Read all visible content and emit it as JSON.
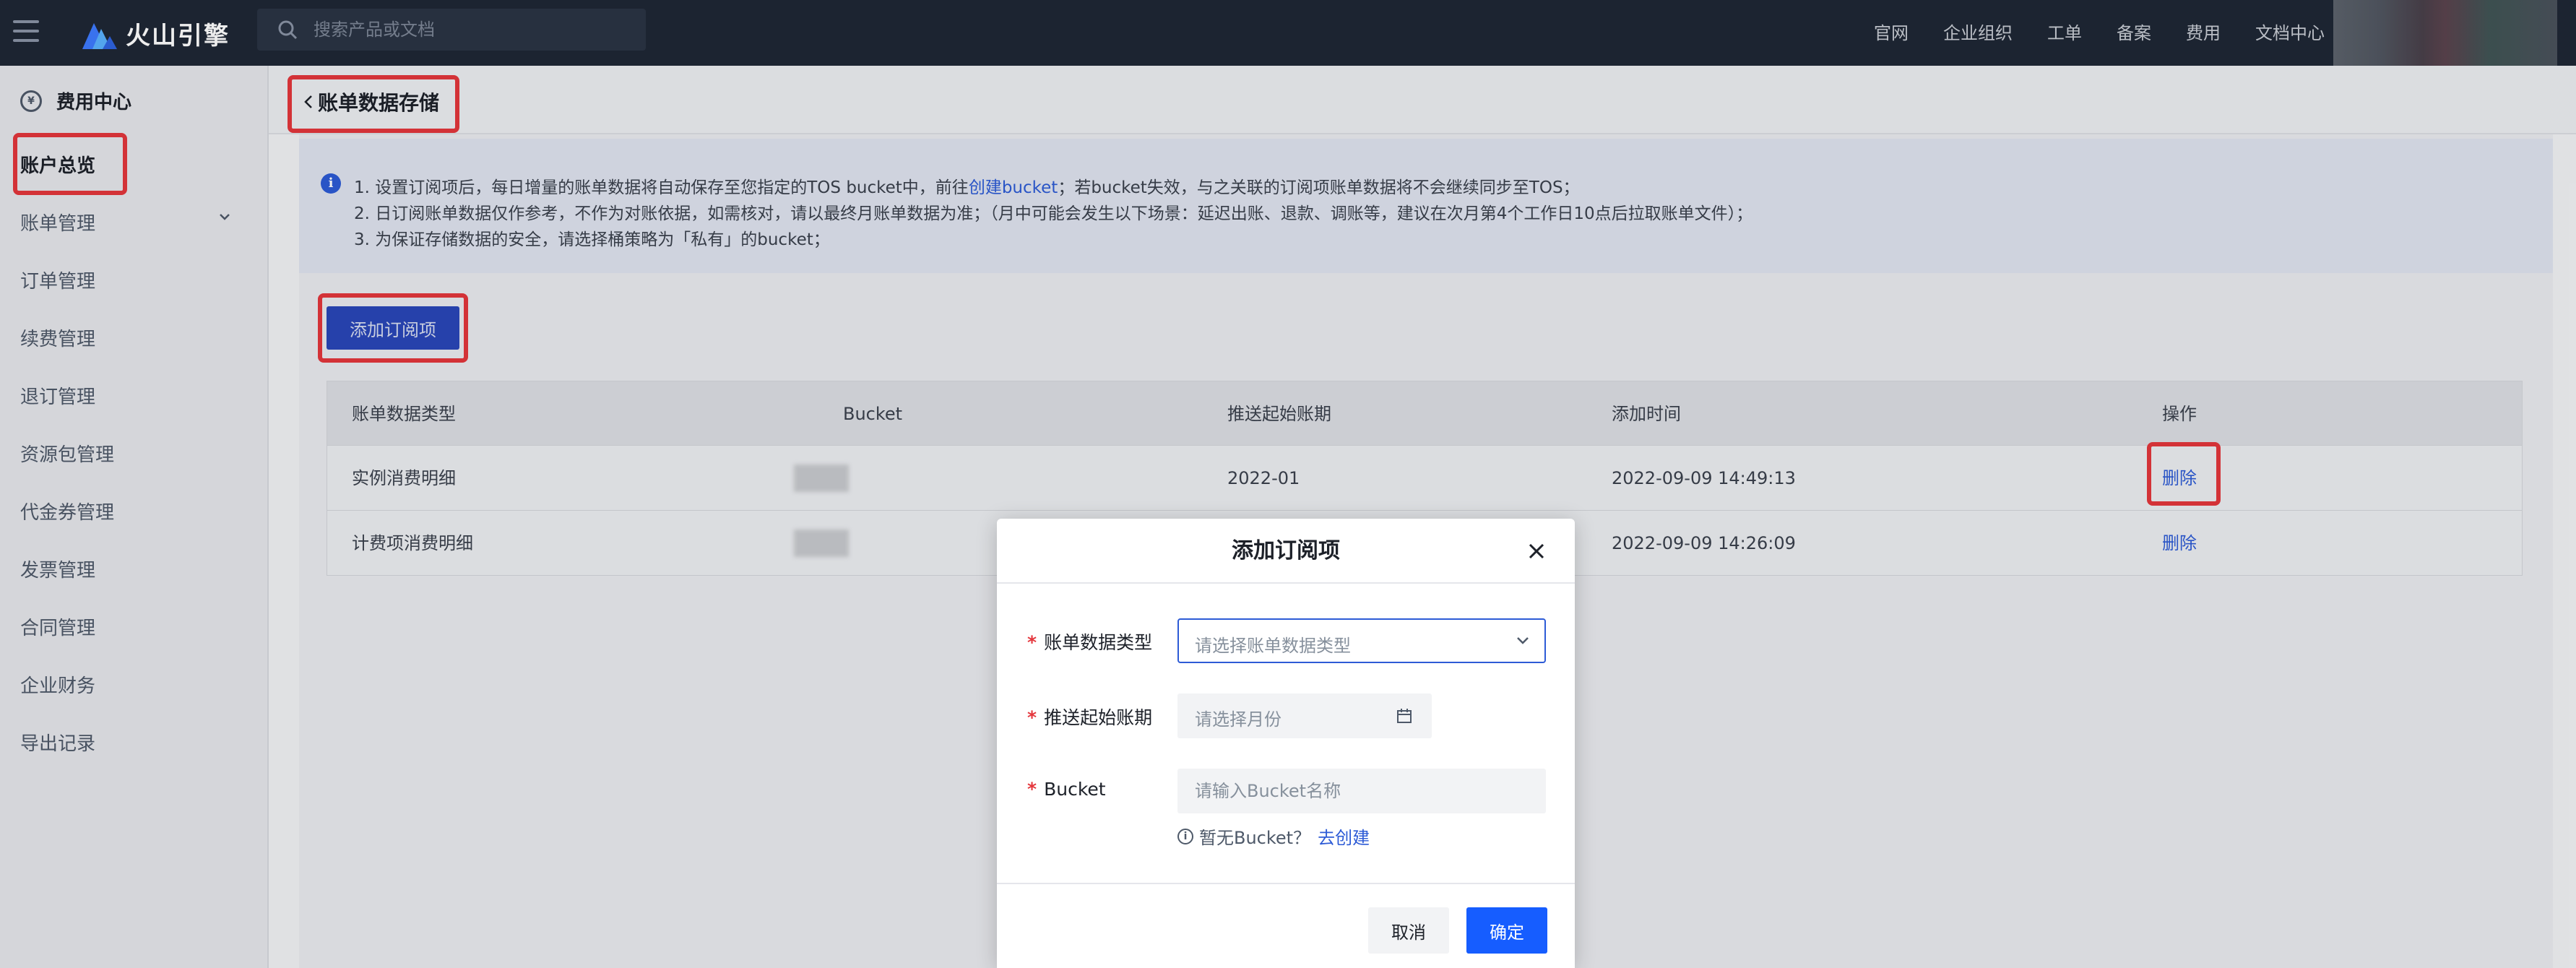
{
  "topbar": {
    "brand": "火山引擎",
    "search_placeholder": "搜索产品或文档",
    "nav": [
      "官网",
      "企业组织",
      "工单",
      "备案",
      "费用",
      "文档中心"
    ]
  },
  "sidebar": {
    "title": "费用中心",
    "items": [
      {
        "label": "账户总览",
        "active": true
      },
      {
        "label": "账单管理",
        "expandable": true
      },
      {
        "label": "订单管理"
      },
      {
        "label": "续费管理"
      },
      {
        "label": "退订管理"
      },
      {
        "label": "资源包管理"
      },
      {
        "label": "代金券管理"
      },
      {
        "label": "发票管理"
      },
      {
        "label": "合同管理"
      },
      {
        "label": "企业财务"
      },
      {
        "label": "导出记录"
      }
    ]
  },
  "page": {
    "back_title": "账单数据存储"
  },
  "notice": {
    "line1_prefix": "1. 设置订阅项后，每日增量的账单数据将自动保存至您指定的TOS bucket中，前往",
    "line1_link": "创建bucket",
    "line1_suffix": "；若bucket失效，与之关联的订阅项账单数据将不会继续同步至TOS；",
    "line2": "2. 日订阅账单数据仅作参考，不作为对账依据，如需核对，请以最终月账单数据为准；（月中可能会发生以下场景：延迟出账、退款、调账等，建议在次月第4个工作日10点后拉取账单文件）；",
    "line3": "3. 为保证存储数据的安全，请选择桶策略为「私有」的bucket；"
  },
  "add_button": "添加订阅项",
  "table": {
    "headers": [
      "账单数据类型",
      "Bucket",
      "推送起始账期",
      "添加时间",
      "操作"
    ],
    "rows": [
      {
        "type": "实例消费明细",
        "start": "2022-01",
        "time": "2022-09-09 14:49:13",
        "action": "删除"
      },
      {
        "type": "计费项消费明细",
        "start": "",
        "time": "2022-09-09 14:26:09",
        "action": "删除"
      }
    ]
  },
  "modal": {
    "title": "添加订阅项",
    "fields": {
      "type_label": "账单数据类型",
      "type_placeholder": "请选择账单数据类型",
      "start_label": "推送起始账期",
      "start_placeholder": "请选择月份",
      "bucket_label": "Bucket",
      "bucket_placeholder": "请输入Bucket名称"
    },
    "required_mark": "*",
    "hint_text": "暂无Bucket？",
    "hint_link": "去创建",
    "cancel": "取消",
    "confirm": "确定"
  }
}
